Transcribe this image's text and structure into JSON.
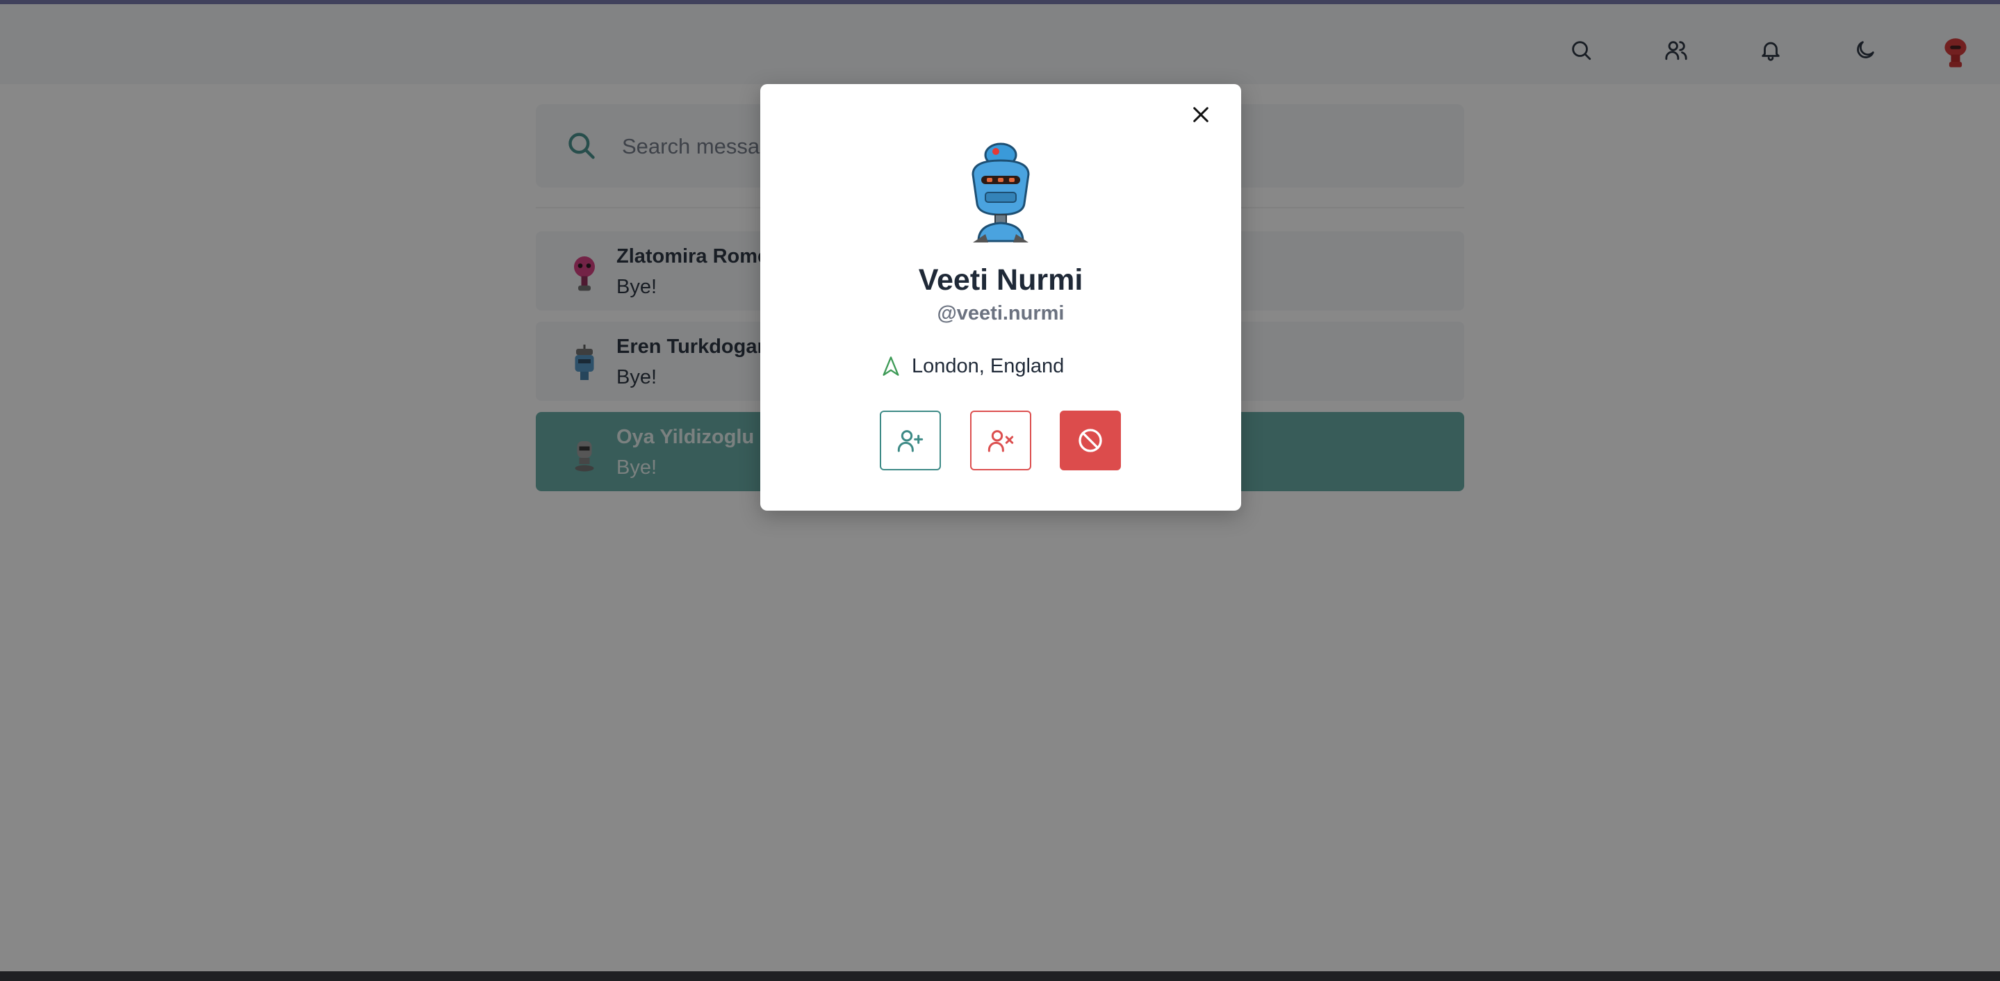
{
  "header": {
    "icons": [
      "search-icon",
      "users-icon",
      "bell-icon",
      "moon-icon"
    ],
    "avatar": "robot-avatar"
  },
  "search": {
    "placeholder": "Search messages"
  },
  "chats": [
    {
      "name": "Zlatomira Romero",
      "message": "Bye!",
      "avatar_color": "#d5347a"
    },
    {
      "name": "Eren Turkdogan",
      "message": "Bye!",
      "avatar_color": "#4a90c2"
    },
    {
      "name": "Oya Yildizoglu",
      "message": "Bye!",
      "avatar_color": "#7a7a7a",
      "active": true
    }
  ],
  "modal": {
    "name": "Veeti Nurmi",
    "handle": "@veeti.nurmi",
    "location": "London, England",
    "buttons": [
      "add-friend",
      "remove-friend",
      "block-user"
    ]
  },
  "colors": {
    "accent": "#3d8a86",
    "danger": "#dc4c4c",
    "active_chat": "#5fa6a1",
    "location_icon": "#3d9a56"
  }
}
